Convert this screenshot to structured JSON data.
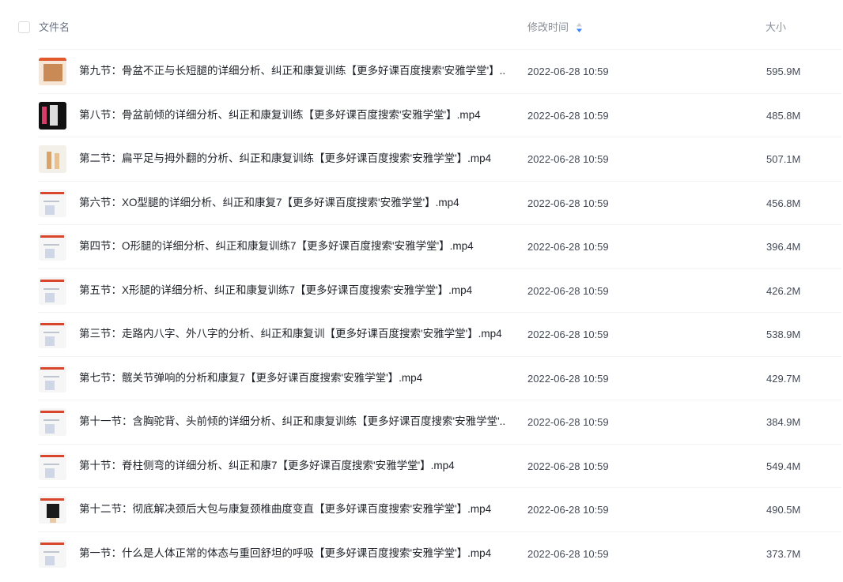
{
  "header": {
    "name_label": "文件名",
    "mtime_label": "修改时间",
    "size_label": "大小",
    "sort_icon": "sort-arrows-icon"
  },
  "colors": {
    "sort_active": "#3b82f6",
    "text_primary": "#1f2329",
    "text_secondary": "#434a56",
    "divider": "#f2f3f5"
  },
  "files": [
    {
      "name": "第九节：骨盆不正与长短腿的详细分析、纠正和康复训练【更多好课百度搜索'安雅学堂'】....",
      "mtime": "2022-06-28 10:59",
      "size": "595.9M",
      "thumb": "thumbnail-pelvis"
    },
    {
      "name": "第八节：骨盆前倾的详细分析、纠正和康复训练【更多好课百度搜索'安雅学堂'】.mp4",
      "mtime": "2022-06-28 10:59",
      "size": "485.8M",
      "thumb": "thumbnail-dark"
    },
    {
      "name": "第二节：扁平足与拇外翻的分析、纠正和康复训练【更多好课百度搜索'安雅学堂'】.mp4",
      "mtime": "2022-06-28 10:59",
      "size": "507.1M",
      "thumb": "thumbnail-feet"
    },
    {
      "name": "第六节：XO型腿的详细分析、纠正和康复7【更多好课百度搜索'安雅学堂'】.mp4",
      "mtime": "2022-06-28 10:59",
      "size": "456.8M",
      "thumb": "thumbnail-slide"
    },
    {
      "name": "第四节：O形腿的详细分析、纠正和康复训练7【更多好课百度搜索'安雅学堂'】.mp4",
      "mtime": "2022-06-28 10:59",
      "size": "396.4M",
      "thumb": "thumbnail-slide"
    },
    {
      "name": "第五节：X形腿的详细分析、纠正和康复训练7【更多好课百度搜索'安雅学堂'】.mp4",
      "mtime": "2022-06-28 10:59",
      "size": "426.2M",
      "thumb": "thumbnail-slide"
    },
    {
      "name": "第三节：走路内八字、外八字的分析、纠正和康复训【更多好课百度搜索'安雅学堂'】.mp4",
      "mtime": "2022-06-28 10:59",
      "size": "538.9M",
      "thumb": "thumbnail-slide"
    },
    {
      "name": "第七节：髋关节弹响的分析和康复7【更多好课百度搜索'安雅学堂'】.mp4",
      "mtime": "2022-06-28 10:59",
      "size": "429.7M",
      "thumb": "thumbnail-slide"
    },
    {
      "name": "第十一节：含胸驼背、头前倾的详细分析、纠正和康复训练【更多好课百度搜索'安雅学堂'...",
      "mtime": "2022-06-28 10:59",
      "size": "384.9M",
      "thumb": "thumbnail-slide"
    },
    {
      "name": "第十节：脊柱侧弯的详细分析、纠正和康7【更多好课百度搜索'安雅学堂'】.mp4",
      "mtime": "2022-06-28 10:59",
      "size": "549.4M",
      "thumb": "thumbnail-slide"
    },
    {
      "name": "第十二节：彻底解决颈后大包与康复颈椎曲度变直【更多好课百度搜索'安雅学堂'】.mp4",
      "mtime": "2022-06-28 10:59",
      "size": "490.5M",
      "thumb": "thumbnail-dark-slide"
    },
    {
      "name": "第一节：什么是人体正常的体态与重回舒坦的呼吸【更多好课百度搜索'安雅学堂'】.mp4",
      "mtime": "2022-06-28 10:59",
      "size": "373.7M",
      "thumb": "thumbnail-slide"
    }
  ]
}
